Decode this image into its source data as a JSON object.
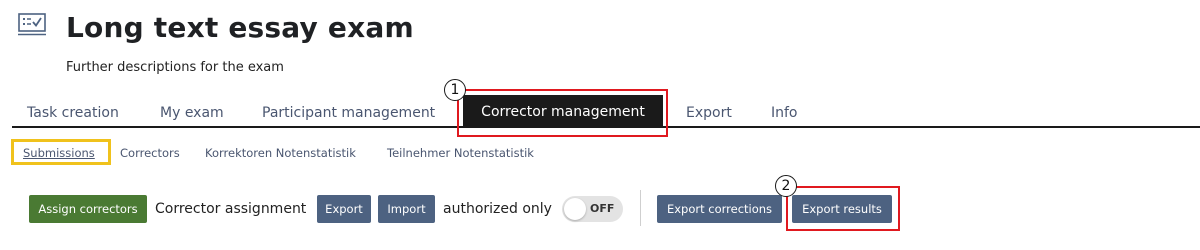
{
  "page": {
    "title": "Long text essay exam",
    "description": "Further descriptions for the exam",
    "title_icon": "checklist-icon"
  },
  "tabs": [
    {
      "label": "Task creation"
    },
    {
      "label": "My exam"
    },
    {
      "label": "Participant management"
    },
    {
      "label": "Corrector management",
      "active": true
    },
    {
      "label": "Export"
    },
    {
      "label": "Info"
    }
  ],
  "subtabs": [
    {
      "label": "Submissions",
      "current": true
    },
    {
      "label": "Correctors"
    },
    {
      "label": "Korrektoren Notenstatistik"
    },
    {
      "label": "Teilnehmer Notenstatistik"
    }
  ],
  "toolbar": {
    "assign_correctors": "Assign correctors",
    "corrector_assignment_label": "Corrector assignment",
    "export": "Export",
    "import": "Import",
    "authorized_only_label": "authorized only",
    "toggle_state": "OFF",
    "export_corrections": "Export corrections",
    "export_results": "Export results"
  },
  "annotations": {
    "marker_1": "1",
    "marker_2": "2"
  },
  "colors": {
    "active_tab": "#1a1a1a",
    "green_button": "#4a7a33",
    "blue_button": "#4d6281",
    "highlight_red": "#e0191f",
    "highlight_yellow": "#f0c21c"
  }
}
